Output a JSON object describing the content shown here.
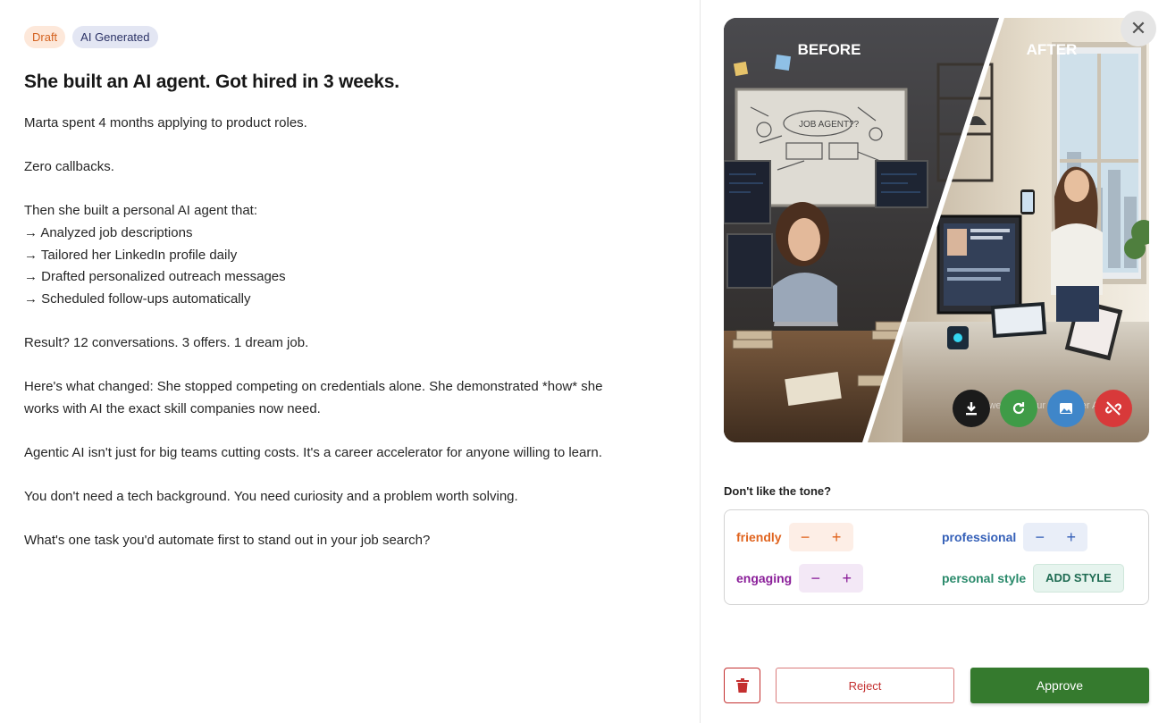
{
  "tags": {
    "draft": "Draft",
    "ai": "AI Generated"
  },
  "post": {
    "title": "She built an AI agent. Got hired in 3 weeks.",
    "paragraphs": [
      [
        "Marta spent 4 months applying to product roles."
      ],
      [
        "Zero callbacks."
      ],
      [
        "Then she built a personal AI agent that:",
        "→ Analyzed job descriptions",
        "→ Tailored her LinkedIn profile daily",
        "→ Drafted personalized outreach messages",
        "→ Scheduled follow-ups automatically"
      ],
      [
        "Result? 12 conversations. 3 offers. 1 dream job."
      ],
      [
        "Here's what changed: She stopped competing on credentials alone. She demonstrated *how* she",
        "works with AI the exact skill companies now need."
      ],
      [
        "Agentic AI isn't just for big teams cutting costs. It's a career accelerator for anyone willing to learn."
      ],
      [
        "You don't need a tech background. You need curiosity and a problem worth solving."
      ],
      [
        "What's one task you'd automate first to stand out in your job search?"
      ]
    ]
  },
  "image": {
    "before_label": "BEFORE",
    "after_label": "AFTER",
    "whiteboard_text": "JOB AGENT??",
    "powered_text": "Powered by our AI Career Assist"
  },
  "media_actions": {
    "download": "download-icon",
    "regenerate": "refresh-icon",
    "replace": "image-icon",
    "detach": "unlink-icon"
  },
  "tone": {
    "label": "Don't like the tone?",
    "friendly": {
      "name": "friendly",
      "color": "#e0641f",
      "bg": "#fdeee6",
      "minus": "−",
      "plus": "+"
    },
    "professional": {
      "name": "professional",
      "color": "#3560b8",
      "bg": "#e9eef8",
      "minus": "−",
      "plus": "+"
    },
    "engaging": {
      "name": "engaging",
      "color": "#8a1e99",
      "bg": "#f3e8f6",
      "minus": "−",
      "plus": "+"
    },
    "personal": {
      "name": "personal style",
      "color": "#2a8a6b",
      "button": "ADD STYLE"
    }
  },
  "actions": {
    "reject": "Reject",
    "approve": "Approve"
  }
}
